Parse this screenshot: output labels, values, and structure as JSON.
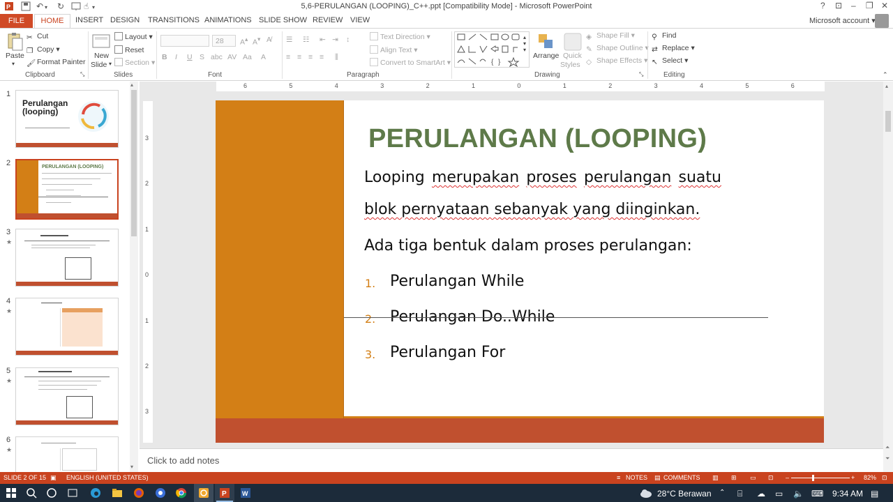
{
  "window": {
    "title": "5,6-PERULANGAN (LOOPING)_C++.ppt [Compatibility Mode] - Microsoft PowerPoint",
    "help": "?",
    "account": "Microsoft account"
  },
  "tabs": [
    "FILE",
    "HOME",
    "INSERT",
    "DESIGN",
    "TRANSITIONS",
    "ANIMATIONS",
    "SLIDE SHOW",
    "REVIEW",
    "VIEW"
  ],
  "ribbon": {
    "clipboard": {
      "paste": "Paste",
      "cut": "Cut",
      "copy": "Copy",
      "format_painter": "Format Painter",
      "label": "Clipboard"
    },
    "slides": {
      "new_slide_1": "New",
      "new_slide_2": "Slide",
      "layout": "Layout",
      "reset": "Reset",
      "section": "Section",
      "label": "Slides"
    },
    "font": {
      "size": "28",
      "label": "Font"
    },
    "paragraph": {
      "text_direction": "Text Direction",
      "align_text": "Align Text",
      "convert_smartart": "Convert to SmartArt",
      "label": "Paragraph"
    },
    "drawing": {
      "arrange": "Arrange",
      "quick_styles_1": "Quick",
      "quick_styles_2": "Styles",
      "shape_fill": "Shape Fill",
      "shape_outline": "Shape Outline",
      "shape_effects": "Shape Effects",
      "label": "Drawing"
    },
    "editing": {
      "find": "Find",
      "replace": "Replace",
      "select": "Select",
      "label": "Editing"
    }
  },
  "thumbnails": [
    {
      "num": "1",
      "title": "Perulangan (looping)"
    },
    {
      "num": "2",
      "title": "PERULANGAN (LOOPING)"
    },
    {
      "num": "3"
    },
    {
      "num": "4"
    },
    {
      "num": "5"
    },
    {
      "num": "6"
    }
  ],
  "slide": {
    "title": "PERULANGAN (LOOPING)",
    "para1_line1": [
      "Looping",
      "merupakan",
      "proses",
      "perulangan",
      "suatu"
    ],
    "para1_line2": "blok pernyataan sebanyak yang diinginkan.",
    "para2": "Ada tiga bentuk dalam proses perulangan:",
    "list": [
      {
        "num": "1.",
        "text": "Perulangan While"
      },
      {
        "num": "2.",
        "text": "Perulangan Do..While"
      },
      {
        "num": "3.",
        "text": "Perulangan For"
      }
    ]
  },
  "ruler": {
    "h": [
      "6",
      "5",
      "4",
      "3",
      "2",
      "1",
      "0",
      "1",
      "2",
      "3",
      "4",
      "5",
      "6"
    ],
    "v": [
      "3",
      "2",
      "1",
      "0",
      "1",
      "2",
      "3"
    ]
  },
  "notes_placeholder": "Click to add notes",
  "status": {
    "slide": "SLIDE 2 OF 15",
    "language": "ENGLISH (UNITED STATES)",
    "notes": "NOTES",
    "comments": "COMMENTS",
    "zoom": "82%"
  },
  "taskbar": {
    "weather": "28°C Berawan",
    "time": "9:34 AM"
  },
  "colors": {
    "accent": "#c9431f",
    "slide_orange": "#d37f16",
    "slide_bar": "#c0502f",
    "title_green": "#5e7a49"
  }
}
